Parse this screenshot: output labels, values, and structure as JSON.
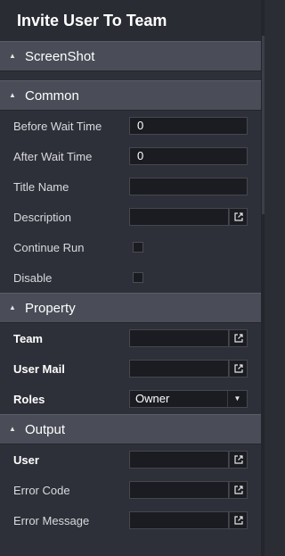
{
  "window": {
    "title": "Invite User To Team"
  },
  "sections": {
    "screenshot": {
      "label": "ScreenShot"
    },
    "common": {
      "label": "Common",
      "before_wait_label": "Before Wait Time",
      "before_wait_value": "0",
      "after_wait_label": "After Wait Time",
      "after_wait_value": "0",
      "title_name_label": "Title Name",
      "title_name_value": "",
      "description_label": "Description",
      "description_value": "",
      "continue_run_label": "Continue Run",
      "disable_label": "Disable"
    },
    "property": {
      "label": "Property",
      "team_label": "Team",
      "team_value": "",
      "user_mail_label": "User Mail",
      "user_mail_value": "",
      "roles_label": "Roles",
      "roles_value": "Owner"
    },
    "output": {
      "label": "Output",
      "user_label": "User",
      "user_value": "",
      "error_code_label": "Error Code",
      "error_code_value": "",
      "error_message_label": "Error Message",
      "error_message_value": ""
    }
  },
  "icons": {
    "collapse": "chevron-up-icon",
    "open_editor": "open-external-icon",
    "dropdown": "chevron-down-icon"
  },
  "colors": {
    "background": "#2e3039",
    "section_header": "#4a4d57",
    "field_background": "#1b1c22"
  }
}
